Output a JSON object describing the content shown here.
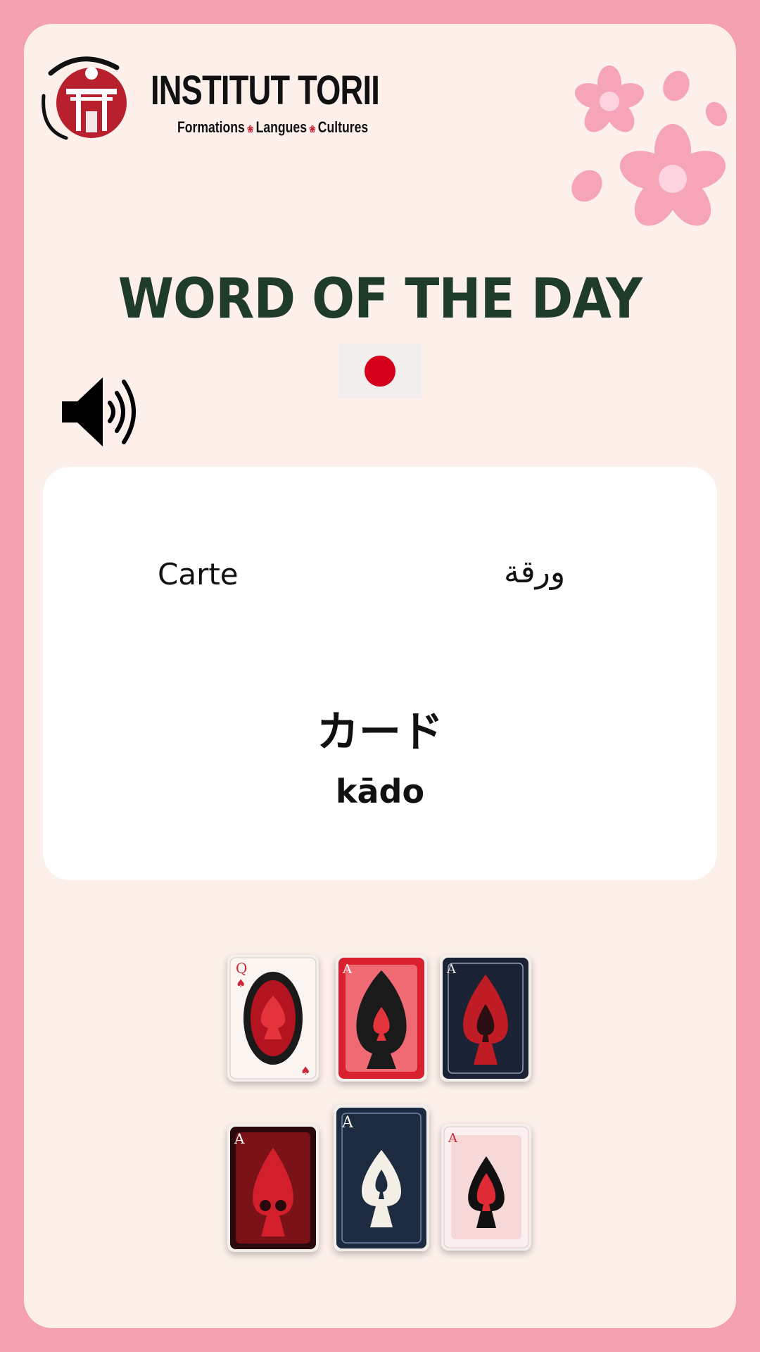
{
  "brand": {
    "name": "INSTITUT TORII",
    "tagline_parts": [
      "Formations",
      "Langues",
      "Cultures"
    ]
  },
  "heading": "WORD OF THE DAY",
  "word": {
    "french": "Carte",
    "arabic": "ورقة",
    "japanese": "カード",
    "romaji": "kādo"
  },
  "icons": {
    "speaker": "speaker-icon",
    "flag": "japan-flag-icon",
    "blossoms": "cherry-blossom-icon"
  },
  "colors": {
    "outer_border": "#f4a1b1",
    "background": "#fdf0ea",
    "heading": "#1f3b2c",
    "flag_red": "#d6001c",
    "accent_red": "#c8283a"
  },
  "playing_cards": [
    {
      "rank": "Q",
      "suit": "spade",
      "style": "light-red"
    },
    {
      "rank": "A",
      "suit": "spade",
      "style": "red"
    },
    {
      "rank": "A",
      "suit": "spade",
      "style": "navy"
    },
    {
      "rank": "A",
      "suit": "spade",
      "style": "dark-red"
    },
    {
      "rank": "A",
      "suit": "spade",
      "style": "navy-white"
    },
    {
      "rank": "A",
      "suit": "spade",
      "style": "light-red"
    }
  ]
}
